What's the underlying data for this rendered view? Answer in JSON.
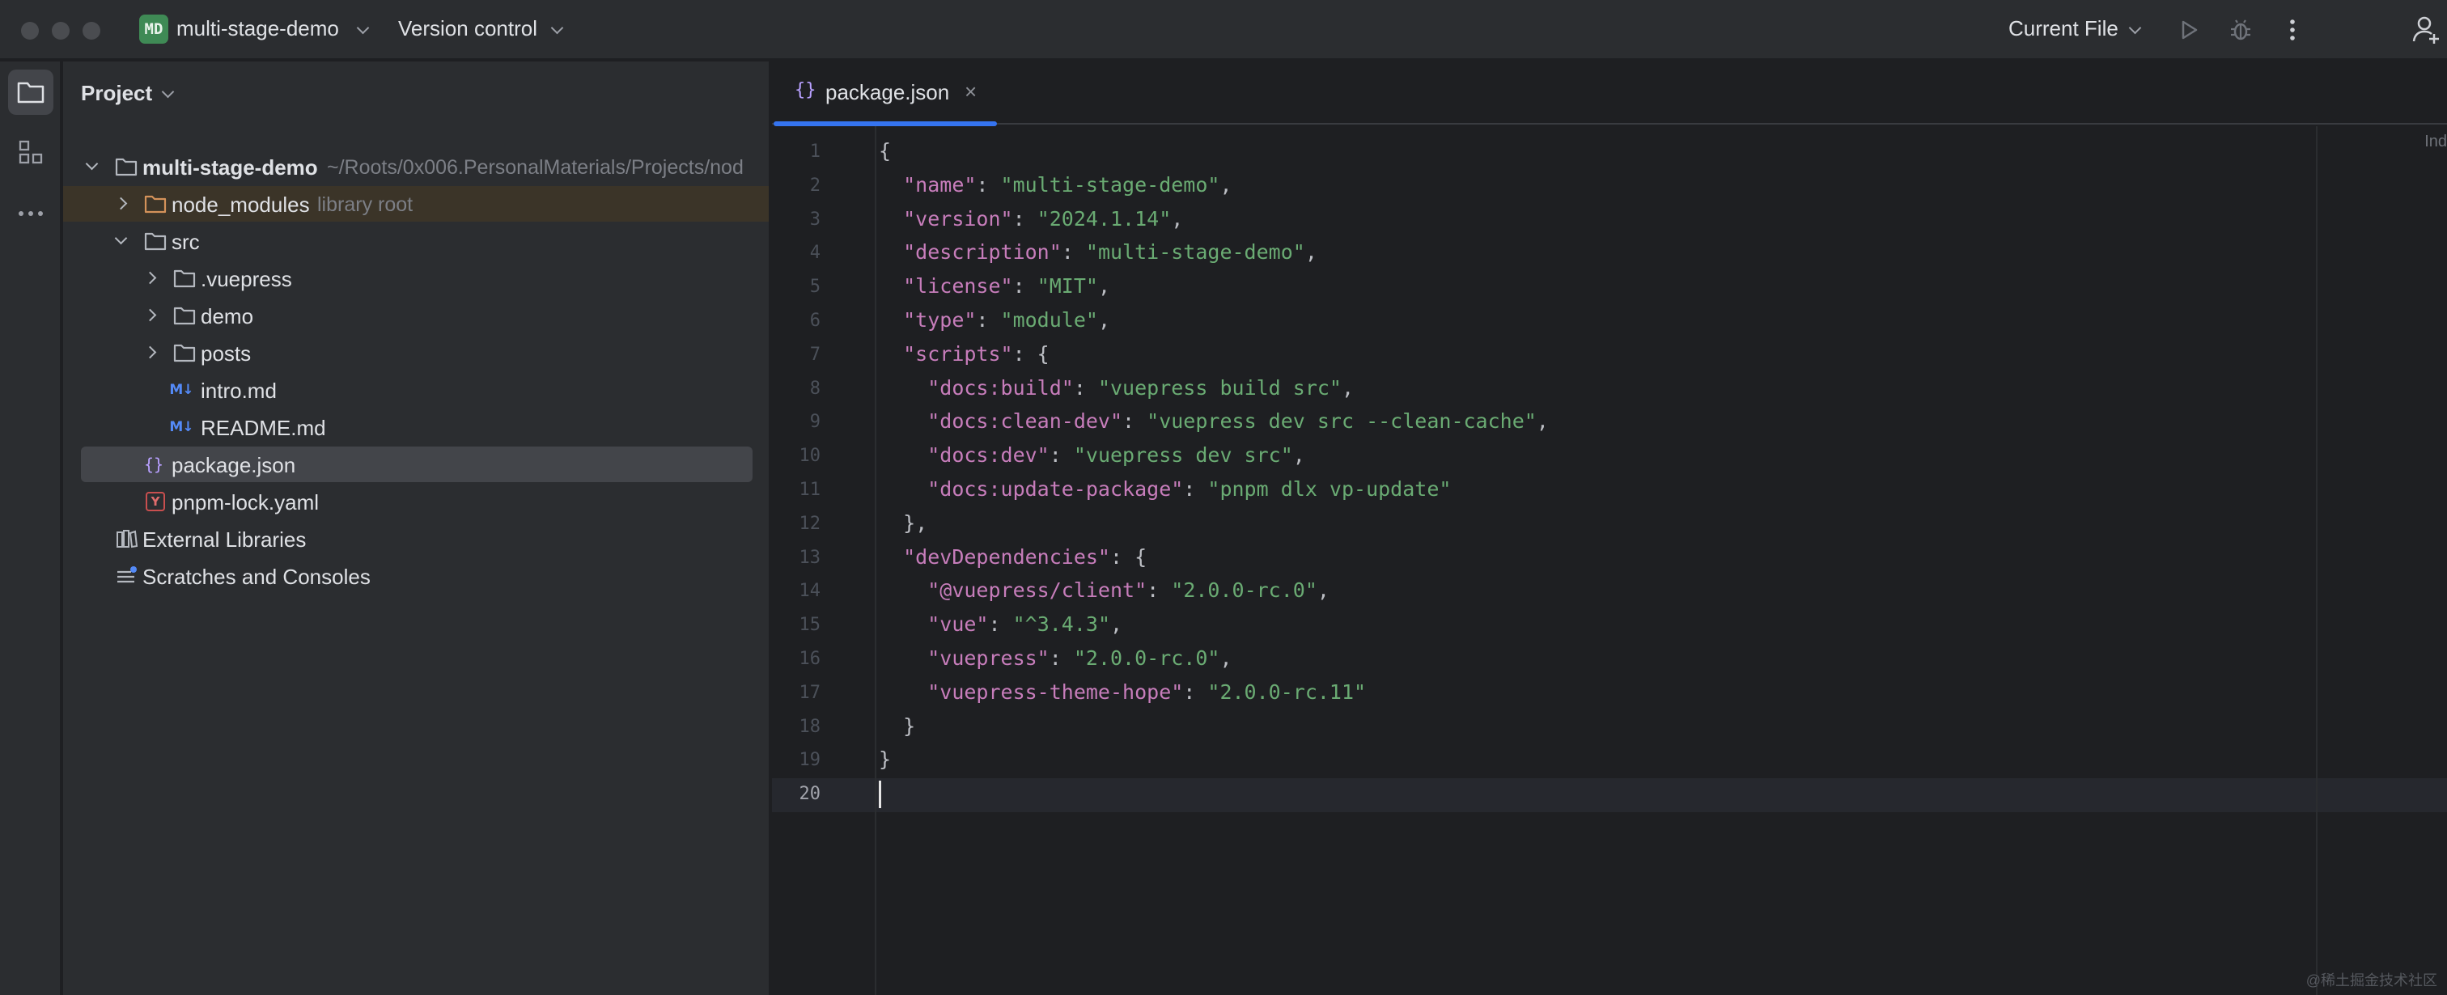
{
  "titlebar": {
    "project_badge": "MD",
    "project_name": "multi-stage-demo",
    "vcs_label": "Version control",
    "run_config": "Current File"
  },
  "toolstrip": {
    "items": [
      "project-icon",
      "structure-icon",
      "more-icon"
    ]
  },
  "project_panel": {
    "title": "Project",
    "root_name": "multi-stage-demo",
    "root_path": "~/Roots/0x006.PersonalMaterials/Projects/nod",
    "node_modules": "node_modules",
    "node_modules_hint": "library root",
    "src": "src",
    "vuepress": ".vuepress",
    "demo": "demo",
    "posts": "posts",
    "intro": "intro.md",
    "readme": "README.md",
    "package_json": "package.json",
    "pnpm_lock": "pnpm-lock.yaml",
    "external_libraries": "External Libraries",
    "scratches": "Scratches and Consoles",
    "md_icon_text": "M↓",
    "json_icon_text": "{}",
    "yaml_icon_text": "Y"
  },
  "editor": {
    "tab_label": "package.json",
    "tab_icon_text": "{}",
    "tab_close": "×",
    "indent_hint": "Ind",
    "current_line": 20,
    "lines": [
      [
        [
          "p",
          "{"
        ]
      ],
      [
        [
          "p",
          "  "
        ],
        [
          "k",
          "\"name\""
        ],
        [
          "p",
          ": "
        ],
        [
          "s",
          "\"multi-stage-demo\""
        ],
        [
          "p",
          ","
        ]
      ],
      [
        [
          "p",
          "  "
        ],
        [
          "k",
          "\"version\""
        ],
        [
          "p",
          ": "
        ],
        [
          "s",
          "\"2024.1.14\""
        ],
        [
          "p",
          ","
        ]
      ],
      [
        [
          "p",
          "  "
        ],
        [
          "k",
          "\"description\""
        ],
        [
          "p",
          ": "
        ],
        [
          "s",
          "\"multi-stage-demo\""
        ],
        [
          "p",
          ","
        ]
      ],
      [
        [
          "p",
          "  "
        ],
        [
          "k",
          "\"license\""
        ],
        [
          "p",
          ": "
        ],
        [
          "s",
          "\"MIT\""
        ],
        [
          "p",
          ","
        ]
      ],
      [
        [
          "p",
          "  "
        ],
        [
          "k",
          "\"type\""
        ],
        [
          "p",
          ": "
        ],
        [
          "s",
          "\"module\""
        ],
        [
          "p",
          ","
        ]
      ],
      [
        [
          "p",
          "  "
        ],
        [
          "k",
          "\"scripts\""
        ],
        [
          "p",
          ": {"
        ]
      ],
      [
        [
          "p",
          "    "
        ],
        [
          "k",
          "\"docs:build\""
        ],
        [
          "p",
          ": "
        ],
        [
          "s",
          "\"vuepress build src\""
        ],
        [
          "p",
          ","
        ]
      ],
      [
        [
          "p",
          "    "
        ],
        [
          "k",
          "\"docs:clean-dev\""
        ],
        [
          "p",
          ": "
        ],
        [
          "s",
          "\"vuepress dev src --clean-cache\""
        ],
        [
          "p",
          ","
        ]
      ],
      [
        [
          "p",
          "    "
        ],
        [
          "k",
          "\"docs:dev\""
        ],
        [
          "p",
          ": "
        ],
        [
          "s",
          "\"vuepress dev src\""
        ],
        [
          "p",
          ","
        ]
      ],
      [
        [
          "p",
          "    "
        ],
        [
          "k",
          "\"docs:update-package\""
        ],
        [
          "p",
          ": "
        ],
        [
          "s",
          "\"pnpm dlx vp-update\""
        ]
      ],
      [
        [
          "p",
          "  },"
        ]
      ],
      [
        [
          "p",
          "  "
        ],
        [
          "k",
          "\"devDependencies\""
        ],
        [
          "p",
          ": {"
        ]
      ],
      [
        [
          "p",
          "    "
        ],
        [
          "k",
          "\"@vuepress/client\""
        ],
        [
          "p",
          ": "
        ],
        [
          "s",
          "\"2.0.0-rc.0\""
        ],
        [
          "p",
          ","
        ]
      ],
      [
        [
          "p",
          "    "
        ],
        [
          "k",
          "\"vue\""
        ],
        [
          "p",
          ": "
        ],
        [
          "s",
          "\"^3.4.3\""
        ],
        [
          "p",
          ","
        ]
      ],
      [
        [
          "p",
          "    "
        ],
        [
          "k",
          "\"vuepress\""
        ],
        [
          "p",
          ": "
        ],
        [
          "s",
          "\"2.0.0-rc.0\""
        ],
        [
          "p",
          ","
        ]
      ],
      [
        [
          "p",
          "    "
        ],
        [
          "k",
          "\"vuepress-theme-hope\""
        ],
        [
          "p",
          ": "
        ],
        [
          "s",
          "\"2.0.0-rc.11\""
        ]
      ],
      [
        [
          "p",
          "  }"
        ]
      ],
      [
        [
          "p",
          "}"
        ]
      ],
      [
        [
          "p",
          ""
        ]
      ]
    ]
  },
  "watermark": "@稀土掘金技术社区",
  "colors": {
    "key": "#c77dbb",
    "string": "#6aab73",
    "punct": "#bcbec4",
    "accent": "#3574f0"
  }
}
